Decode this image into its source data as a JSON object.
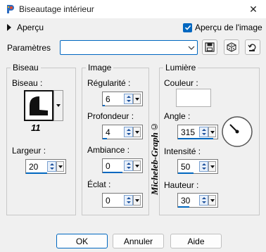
{
  "window": {
    "title": "Biseautage intérieur"
  },
  "preview": {
    "toggle_label": "Aperçu",
    "checkbox_label": "Aperçu de l'image",
    "checked": true
  },
  "params": {
    "label": "Paramètres",
    "value": ""
  },
  "groups": {
    "bevel": {
      "title": "Biseau",
      "bevel_label": "Biseau :",
      "bevel_number": "11",
      "width_label": "Largeur :",
      "width_value": "20"
    },
    "image": {
      "title": "Image",
      "regularity_label": "Régularité :",
      "regularity_value": "6",
      "depth_label": "Profondeur :",
      "depth_value": "4",
      "ambience_label": "Ambiance :",
      "ambience_value": "0",
      "shine_label": "Éclat :",
      "shine_value": "0"
    },
    "light": {
      "title": "Lumière",
      "color_label": "Couleur :",
      "color_value": "#ffffff",
      "angle_label": "Angle :",
      "angle_value": "315",
      "intensity_label": "Intensité :",
      "intensity_value": "50",
      "height_label": "Hauteur :",
      "height_value": "30"
    }
  },
  "watermark": "Micheleb-Graph©",
  "buttons": {
    "ok": "OK",
    "cancel": "Annuler",
    "help": "Aide"
  },
  "colors": {
    "accent": "#0067c0",
    "background": "#f0f0f0"
  }
}
